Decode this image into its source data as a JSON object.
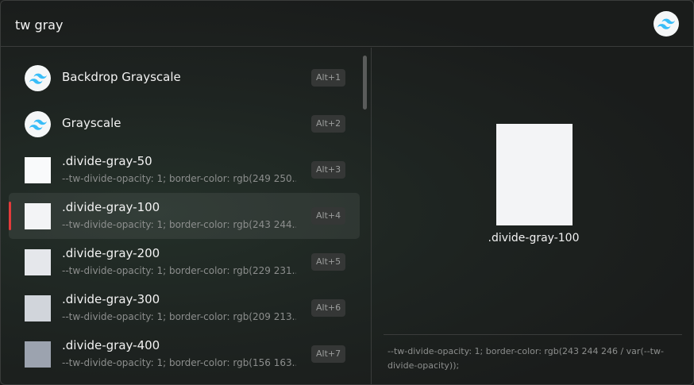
{
  "search": {
    "value": "tw gray"
  },
  "results": [
    {
      "title": "Backdrop Grayscale",
      "subtitle": "",
      "shortcut": "Alt+1",
      "icon": "tailwind-logo-icon",
      "color": ""
    },
    {
      "title": "Grayscale",
      "subtitle": "",
      "shortcut": "Alt+2",
      "icon": "tailwind-logo-icon",
      "color": ""
    },
    {
      "title": ".divide-gray-50",
      "subtitle": "--tw-divide-opacity: 1; border-color: rgb(249 250...",
      "shortcut": "Alt+3",
      "icon": "color-swatch-icon",
      "color": "#f9fafb"
    },
    {
      "title": ".divide-gray-100",
      "subtitle": "--tw-divide-opacity: 1; border-color: rgb(243 244...",
      "shortcut": "Alt+4",
      "icon": "color-swatch-icon",
      "color": "#f3f4f6"
    },
    {
      "title": ".divide-gray-200",
      "subtitle": "--tw-divide-opacity: 1; border-color: rgb(229 231...",
      "shortcut": "Alt+5",
      "icon": "color-swatch-icon",
      "color": "#e5e7eb"
    },
    {
      "title": ".divide-gray-300",
      "subtitle": "--tw-divide-opacity: 1; border-color: rgb(209 213...",
      "shortcut": "Alt+6",
      "icon": "color-swatch-icon",
      "color": "#d1d5db"
    },
    {
      "title": ".divide-gray-400",
      "subtitle": "--tw-divide-opacity: 1; border-color: rgb(156 163...",
      "shortcut": "Alt+7",
      "icon": "color-swatch-icon",
      "color": "#9ca3af"
    }
  ],
  "selected_index": 3,
  "preview": {
    "label": ".divide-gray-100",
    "color": "#f3f4f6",
    "code": "--tw-divide-opacity: 1; border-color: rgb(243 244 246 / var(--tw-divide-opacity));"
  },
  "colors": {
    "accent": "#e23b3b",
    "tailwind": "#38bdf8"
  }
}
